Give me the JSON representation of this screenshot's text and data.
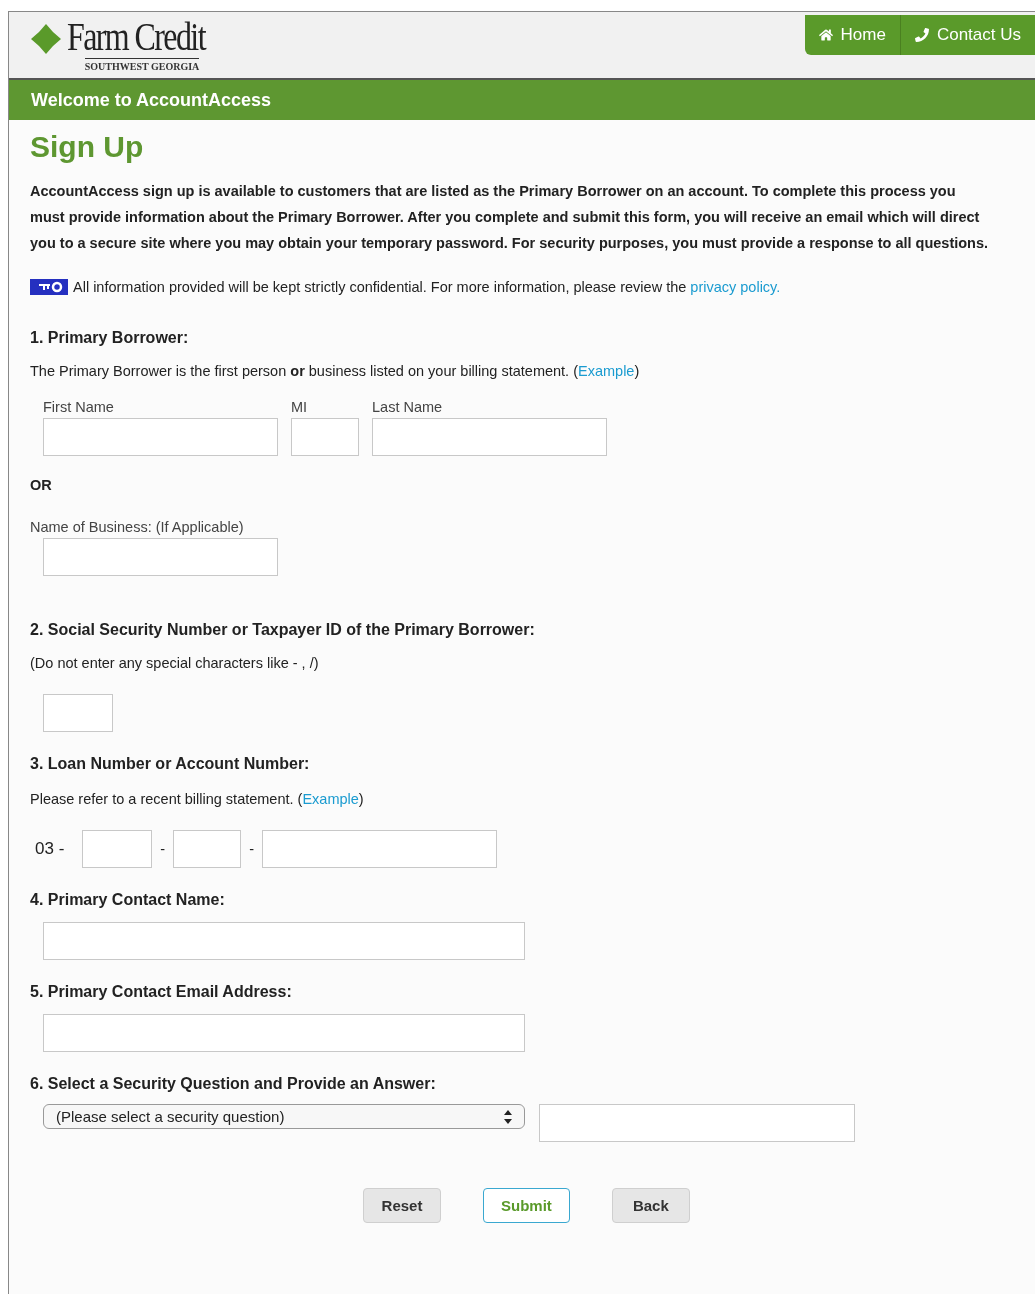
{
  "header": {
    "logo_name": "Farm Credit",
    "logo_tagline": "SOUTHWEST GEORGIA",
    "nav": [
      {
        "kind": "home",
        "label": "Home"
      },
      {
        "kind": "phone",
        "label": "Contact Us"
      }
    ]
  },
  "banner": "Welcome to AccountAccess",
  "title": "Sign Up",
  "intro": "AccountAccess sign up is available to customers that are listed as the Primary Borrower on an account. To complete this process you must provide information about the Primary Borrower. After you complete and submit this form, you will receive an email which will direct you to a secure site where you may obtain your temporary password. For security purposes, you must provide a response to all questions.",
  "privacy": {
    "text": "All information provided will be kept strictly confidential. For more information, please review the",
    "link": "privacy policy."
  },
  "section1": {
    "heading": "1. Primary Borrower:",
    "note_before": "The Primary Borrower is the first person **or** business listed on your billing statement. (",
    "link": "Example",
    "note_after": ")",
    "fields": [
      {
        "label": "First Name"
      },
      {
        "label": "MI"
      },
      {
        "label": "Last Name"
      }
    ],
    "or": "OR",
    "business_label": "Name of Business: (If Applicable)"
  },
  "section2": {
    "heading": "2. Social Security Number or Taxpayer ID of the Primary Borrower:",
    "note": "(Do not enter any special characters like - , /)"
  },
  "section3": {
    "heading": "3. Loan Number or Account Number:",
    "note_before": "Please refer to a recent billing statement. (",
    "link": "Example",
    "note_after": ")",
    "prefix": "03 -",
    "separators": [
      "-",
      "-"
    ]
  },
  "section4": {
    "heading": "4. Primary Contact Name:"
  },
  "section5": {
    "heading": "5. Primary Contact Email Address:"
  },
  "section6": {
    "heading": "6. Select a Security Question and Provide an Answer:",
    "select": "(Please select a security question)"
  },
  "buttons": [
    {
      "label": "Reset",
      "kind": "secondary"
    },
    {
      "label": "Submit",
      "kind": "primary"
    },
    {
      "label": "Back",
      "kind": "secondary"
    }
  ]
}
